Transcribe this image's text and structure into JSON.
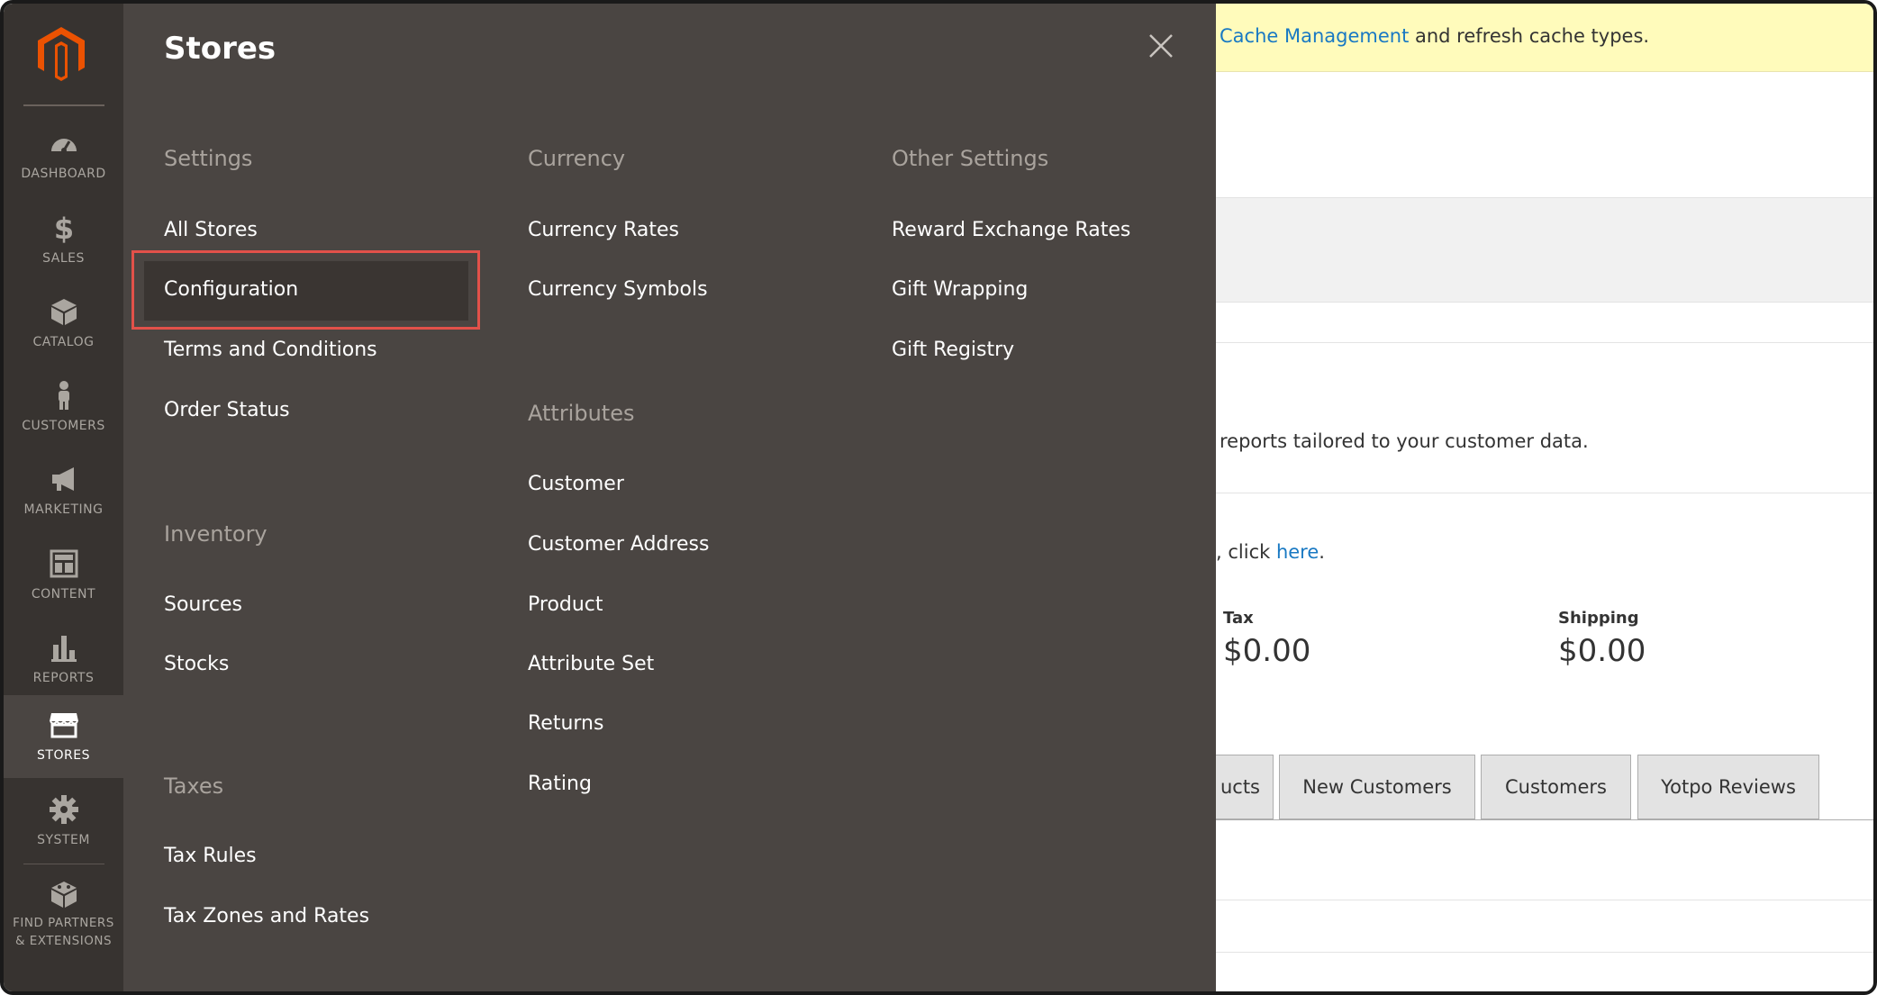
{
  "sidebar": {
    "logo": "magento-logo",
    "items": [
      {
        "label": "DASHBOARD",
        "icon": "dashboard-icon"
      },
      {
        "label": "SALES",
        "icon": "dollar-icon"
      },
      {
        "label": "CATALOG",
        "icon": "box-icon"
      },
      {
        "label": "CUSTOMERS",
        "icon": "person-icon"
      },
      {
        "label": "MARKETING",
        "icon": "megaphone-icon"
      },
      {
        "label": "CONTENT",
        "icon": "layout-icon"
      },
      {
        "label": "REPORTS",
        "icon": "bar-chart-icon"
      },
      {
        "label": "STORES",
        "icon": "storefront-icon",
        "active": true
      },
      {
        "label": "SYSTEM",
        "icon": "gear-icon"
      },
      {
        "label_line1": "FIND PARTNERS",
        "label_line2": "& EXTENSIONS",
        "icon": "extensions-icon"
      }
    ]
  },
  "flyout": {
    "title": "Stores",
    "settings": {
      "title": "Settings",
      "links": [
        "All Stores",
        "Configuration",
        "Terms and Conditions",
        "Order Status"
      ],
      "highlighted": "Configuration"
    },
    "inventory": {
      "title": "Inventory",
      "links": [
        "Sources",
        "Stocks"
      ]
    },
    "taxes": {
      "title": "Taxes",
      "links": [
        "Tax Rules",
        "Tax Zones and Rates"
      ]
    },
    "currency": {
      "title": "Currency",
      "links": [
        "Currency Rates",
        "Currency Symbols"
      ]
    },
    "attributes": {
      "title": "Attributes",
      "links": [
        "Customer",
        "Customer Address",
        "Product",
        "Attribute Set",
        "Returns",
        "Rating"
      ]
    },
    "other_settings": {
      "title": "Other Settings",
      "links": [
        "Reward Exchange Rates",
        "Gift Wrapping",
        "Gift Registry"
      ]
    }
  },
  "background": {
    "notice_link": "Cache Management",
    "notice_rest": " and refresh cache types.",
    "reports_text": "reports tailored to your customer data.",
    "click_prefix": ", click ",
    "click_link": "here",
    "click_suffix": ".",
    "tax_label": "Tax",
    "tax_value": "$0.00",
    "shipping_label": "Shipping",
    "shipping_value": "$0.00",
    "tabs": [
      "ucts",
      "New Customers",
      "Customers",
      "Yotpo Reviews"
    ]
  },
  "colors": {
    "sidebar_bg": "#373330",
    "flyout_bg": "#4a4542",
    "highlight_border": "#e2514a",
    "link": "#1979c3",
    "notice_bg": "#fffbbb",
    "brand_orange": "#eb5202"
  }
}
